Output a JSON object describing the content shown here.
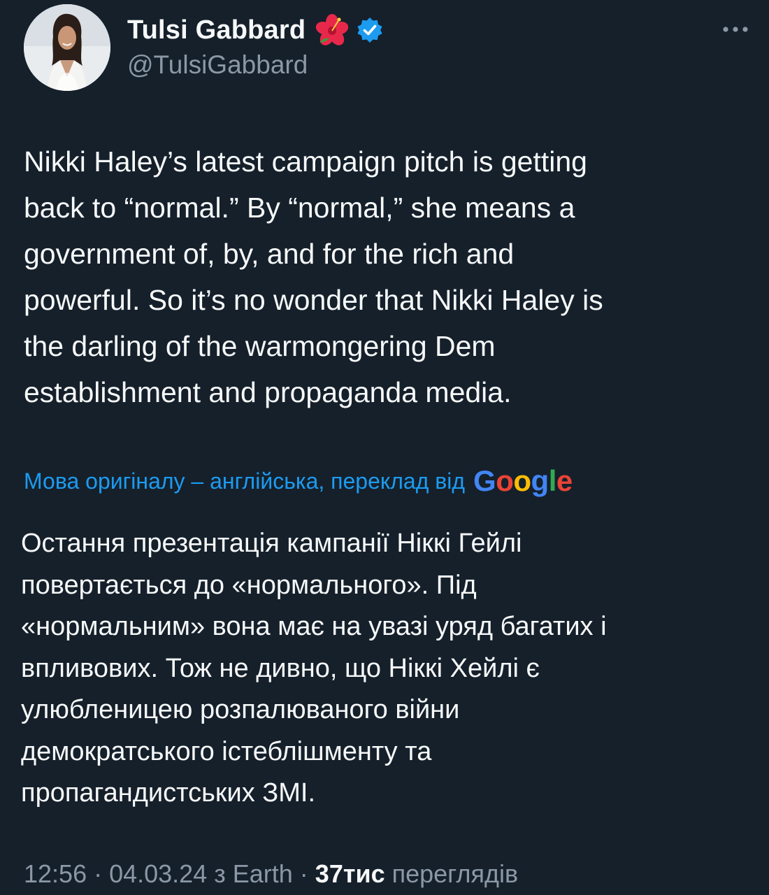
{
  "author": {
    "display_name": "Tulsi Gabbard",
    "handle": "@TulsiGabbard",
    "emoji_icon": "hibiscus-icon",
    "verified_icon": "verified-badge-icon",
    "avatar_icon": "profile-photo"
  },
  "menu": {
    "more_icon": "more-options-icon"
  },
  "tweet": {
    "text": "Nikki Haley’s latest campaign pitch is getting\nback to “normal.” By “normal,” she means a\ngovernment of, by, and for the rich and\npowerful. So it’s no wonder that Nikki Haley is\nthe darling of the warmongering Dem\nestablishment and propaganda media."
  },
  "translation": {
    "label": "Мова оригіналу – англійська, переклад від",
    "provider": "Google",
    "text": "Остання презентація кампанії Ніккі Гейлі\nповертається до «нормального». Під\n«нормальним» вона має на увазі уряд багатих і\nвпливових. Тож не дивно, що Ніккі Хейлі є\nулюбленицею розпалюваного війни\nдемократського істеблішменту та\nпропагандистських ЗМІ."
  },
  "meta": {
    "time": "12:56",
    "date": "04.03.24",
    "source": "з Earth",
    "views_count": "37тис",
    "views_label": "переглядів"
  },
  "colors": {
    "background": "#15202b",
    "text_primary": "#f7f9f9",
    "text_secondary": "#8b98a5",
    "accent_blue": "#1d9bf0",
    "google_blue": "#4285f4",
    "google_red": "#ea4335",
    "google_yellow": "#fbbc05",
    "google_green": "#34a853"
  }
}
